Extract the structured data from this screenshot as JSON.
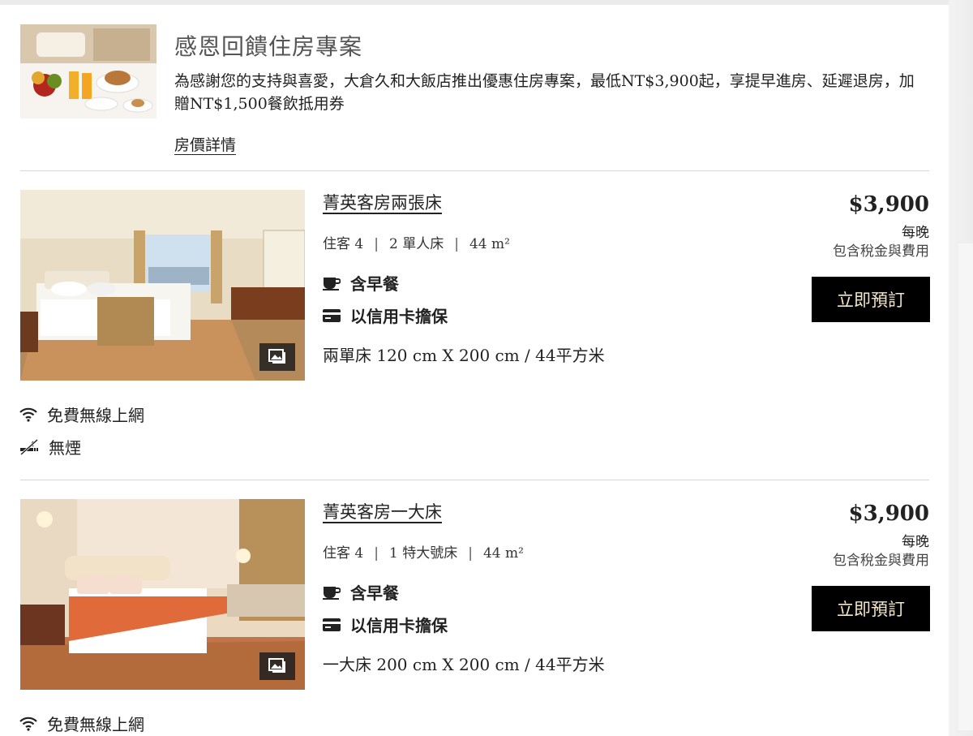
{
  "promo": {
    "title": "感恩回饋住房專案",
    "description": "為感謝您的支持與喜愛，大倉久和大飯店推出優惠住房專案，最低NT$3,900起，享提早進房、延遲退房，加贈NT$1,500餐飲抵用券",
    "link_label": "房價詳情"
  },
  "rooms": [
    {
      "name": "菁英客房兩張床",
      "guests": "住客 4",
      "beds": "2 單人床",
      "size": "44 m²",
      "perks": [
        "含早餐",
        "以信用卡擔保"
      ],
      "bed_info": "兩單床 120 cm X 200 cm / 44平方米",
      "price": "$3,900",
      "per_night": "每晚",
      "tax_note": "包含稅金與費用",
      "book_label": "立即預訂",
      "amenities": [
        "免費無線上網",
        "無煙"
      ]
    },
    {
      "name": "菁英客房一大床",
      "guests": "住客 4",
      "beds": "1 特大號床",
      "size": "44 m²",
      "perks": [
        "含早餐",
        "以信用卡擔保"
      ],
      "bed_info": "一大床 200 cm X 200 cm / 44平方米",
      "price": "$3,900",
      "per_night": "每晚",
      "tax_note": "包含稅金與費用",
      "book_label": "立即預訂",
      "amenities": [
        "免費無線上網"
      ]
    }
  ],
  "icons": {
    "breakfast": "coffee-cup-icon",
    "guarantee": "credit-card-icon",
    "wifi": "wifi-icon",
    "no_smoking": "no-smoking-icon",
    "gallery": "gallery-icon"
  },
  "colors": {
    "button_bg": "#000000",
    "button_text": "#f3e7c9",
    "divider": "#d6d6d6"
  }
}
